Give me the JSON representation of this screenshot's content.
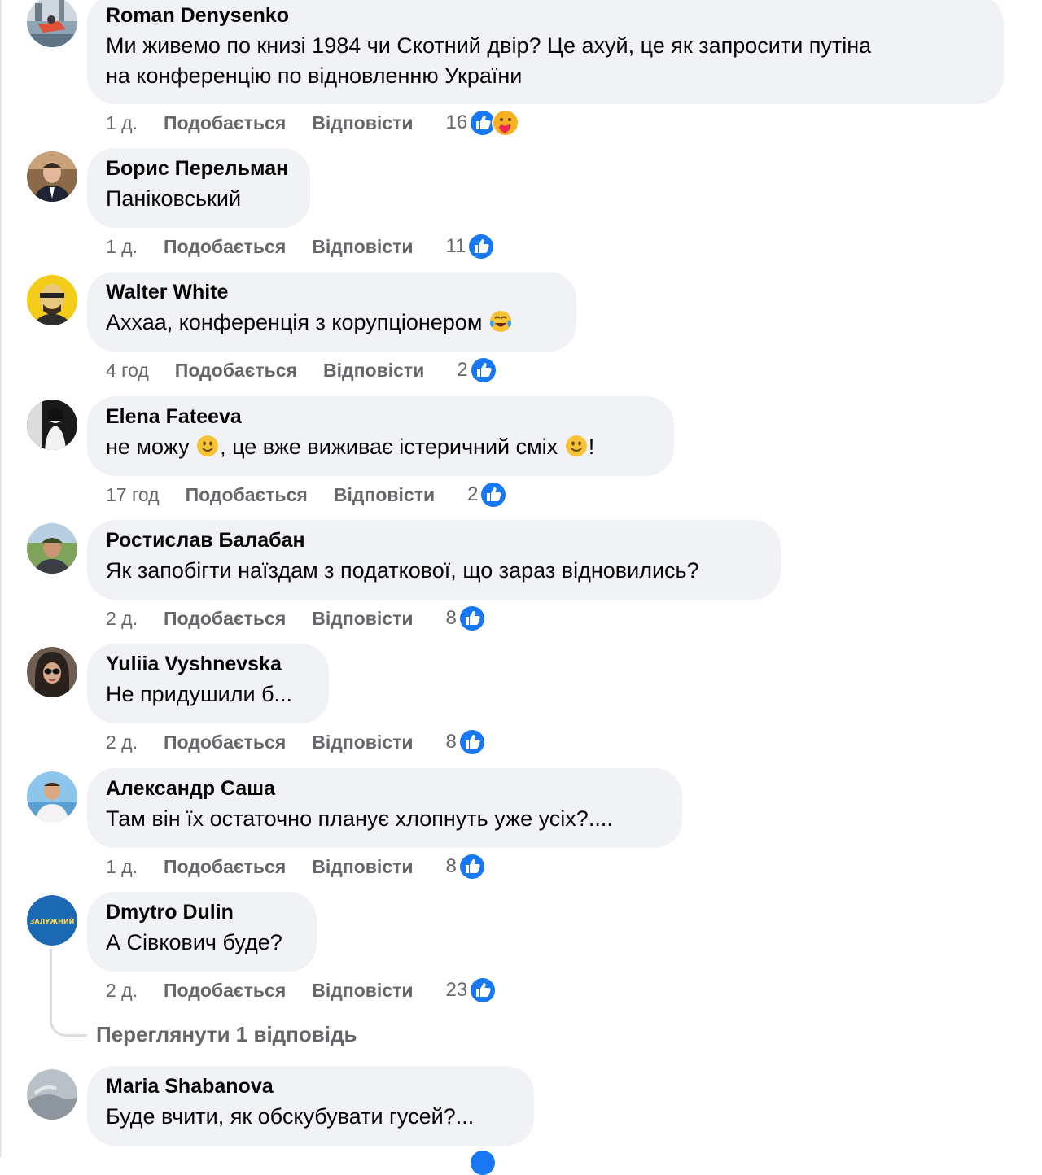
{
  "labels": {
    "like": "Подобається",
    "reply": "Відповісти"
  },
  "colors": {
    "bubble_bg": "#f0f2f5",
    "meta_text": "#65676b",
    "like_blue": "#1877f2"
  },
  "comments": [
    {
      "author": "Roman Denysenko",
      "text_lines": [
        "Ми живемо по книзі 1984 чи Скотний двір? Це ахуй, це як запросити путіна",
        "на конференцію по відновленню України"
      ],
      "time": "1 д.",
      "count": "16",
      "reactions": [
        "like-icon",
        "care-icon"
      ]
    },
    {
      "author": "Борис Перельман",
      "text": "Паніковський",
      "time": "1 д.",
      "count": "11",
      "reactions": [
        "like-icon"
      ]
    },
    {
      "author": "Walter White",
      "text": "Аххаа, конференція з корупціонером",
      "emoji": "tears-of-joy",
      "time": "4 год",
      "count": "2",
      "reactions": [
        "like-icon"
      ]
    },
    {
      "author": "Elena Fateeva",
      "text_part1": "не можу",
      "text_part2": ", це вже виживає істеричний сміх",
      "text_part3": "!",
      "emoji": "slight-smile",
      "time": "17 год",
      "count": "2",
      "reactions": [
        "like-icon"
      ]
    },
    {
      "author": "Ростислав Балабан",
      "text": "Як запобігти наїздам з податкової, що зараз відновились?",
      "time": "2 д.",
      "count": "8",
      "reactions": [
        "like-icon"
      ]
    },
    {
      "author": "Yuliia Vyshnevska",
      "text": "Не придушили б...",
      "time": "2 д.",
      "count": "8",
      "reactions": [
        "like-icon"
      ]
    },
    {
      "author": "Александр Саша",
      "text": "Там він їх остаточно планує хлопнуть уже усіх?....",
      "time": "1 д.",
      "count": "8",
      "reactions": [
        "like-icon"
      ]
    },
    {
      "author": "Dmytro Dulin",
      "text": "А Сівкович буде?",
      "time": "2 д.",
      "count": "23",
      "reactions": [
        "like-icon"
      ],
      "avatar_text": "ЗАЛУЖНИЙ"
    },
    {
      "author": "Maria Shabanova",
      "text": "Буде вчити, як обскубувати гусей?..."
    }
  ],
  "view_replies": "Переглянути 1 відповідь"
}
